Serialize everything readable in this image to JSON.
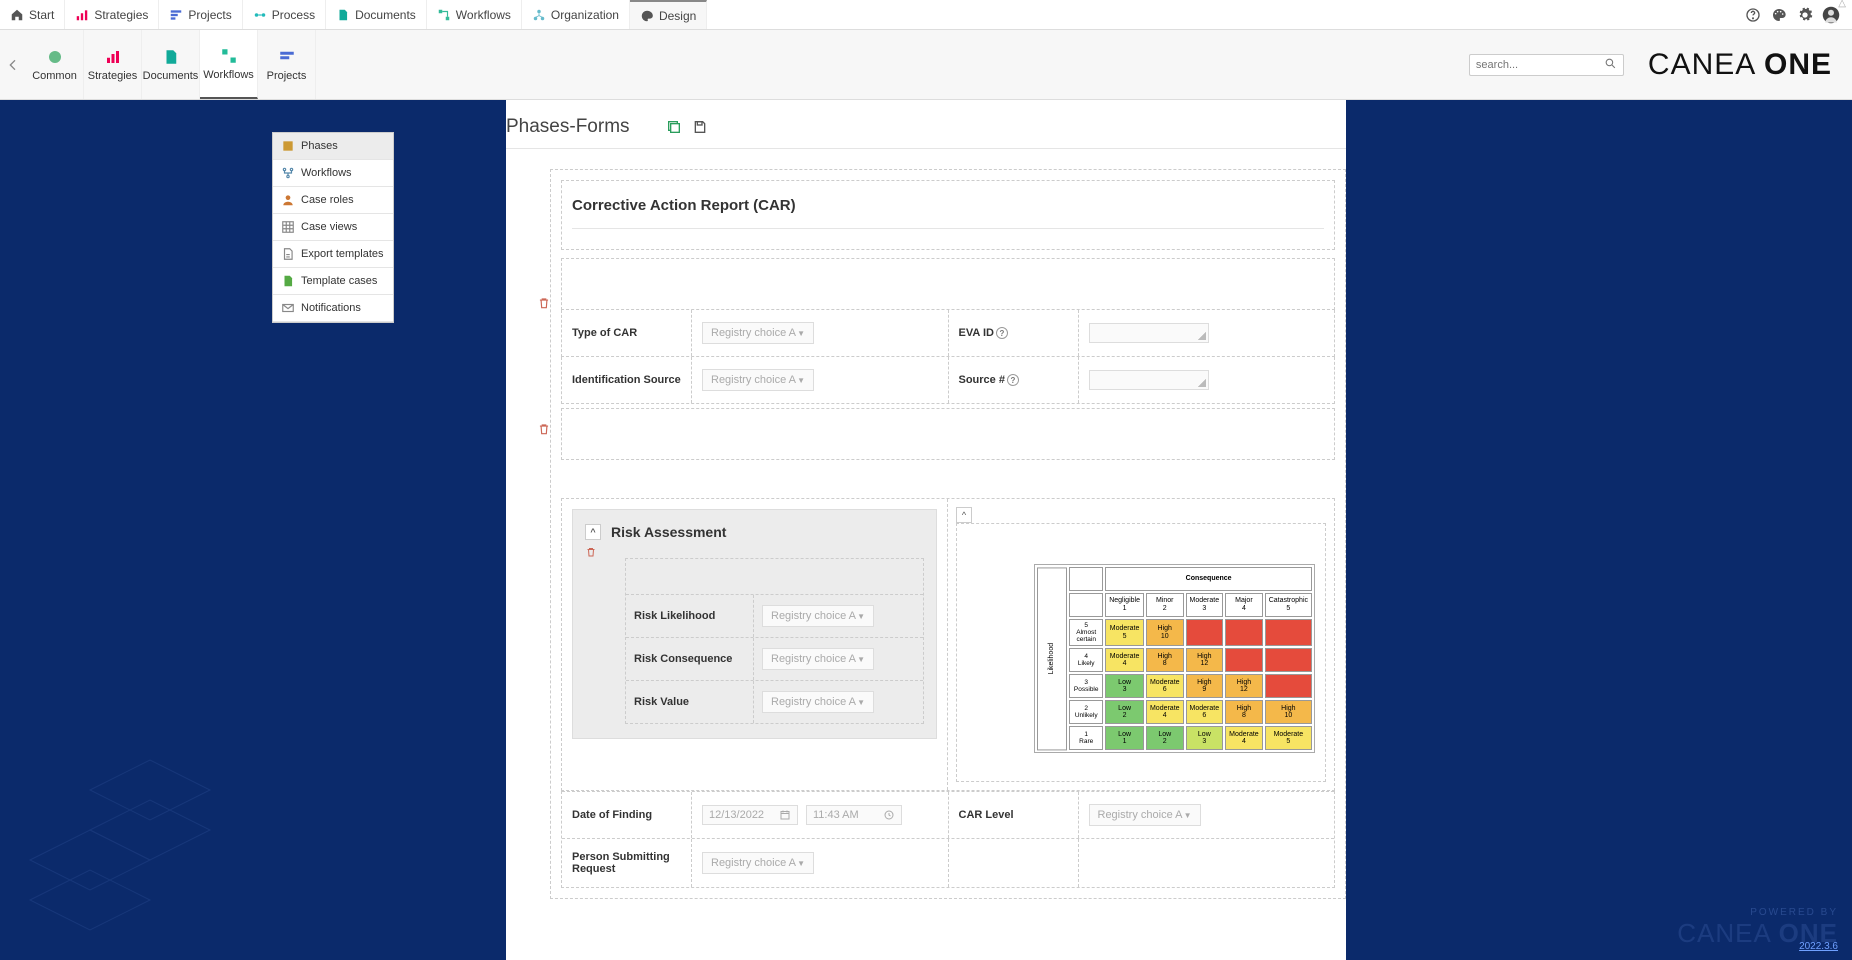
{
  "topnav": {
    "tabs": [
      {
        "label": "Start",
        "icon": "home"
      },
      {
        "label": "Strategies",
        "icon": "signal"
      },
      {
        "label": "Projects",
        "icon": "proj"
      },
      {
        "label": "Process",
        "icon": "process"
      },
      {
        "label": "Documents",
        "icon": "doc"
      },
      {
        "label": "Workflows",
        "icon": "flow"
      },
      {
        "label": "Organization",
        "icon": "org"
      },
      {
        "label": "Design",
        "icon": "design"
      }
    ],
    "active_index": 7
  },
  "ribbon": {
    "items": [
      {
        "label": "Common"
      },
      {
        "label": "Strategies"
      },
      {
        "label": "Documents"
      },
      {
        "label": "Workflows"
      },
      {
        "label": "Projects"
      }
    ],
    "active_index": 3,
    "search_placeholder": "search..."
  },
  "brand": {
    "left": "CANEA",
    "right": "ONE"
  },
  "sidebar": {
    "items": [
      {
        "label": "Phases"
      },
      {
        "label": "Workflows"
      },
      {
        "label": "Case roles"
      },
      {
        "label": "Case views"
      },
      {
        "label": "Export templates"
      },
      {
        "label": "Template cases"
      },
      {
        "label": "Notifications"
      }
    ],
    "active_index": 0
  },
  "page": {
    "title": "Phases-Forms",
    "form_title": "Corrective Action Report (CAR)"
  },
  "fields": {
    "type_of_car": {
      "label": "Type of CAR",
      "placeholder": "Registry choice A"
    },
    "eva_id": {
      "label": "EVA ID"
    },
    "identification_source": {
      "label": "Identification Source",
      "placeholder": "Registry choice A"
    },
    "source_num": {
      "label": "Source #"
    },
    "risk": {
      "title": "Risk Assessment",
      "likelihood": {
        "label": "Risk Likelihood",
        "placeholder": "Registry choice A"
      },
      "consequence": {
        "label": "Risk Consequence",
        "placeholder": "Registry choice A"
      },
      "value": {
        "label": "Risk Value",
        "placeholder": "Registry choice A"
      }
    },
    "date_of_finding": {
      "label": "Date of Finding",
      "date": "12/13/2022",
      "time": "11:43 AM"
    },
    "car_level": {
      "label": "CAR Level",
      "placeholder": "Registry choice A"
    },
    "submitter": {
      "label": "Person Submitting Request",
      "placeholder": "Registry choice A"
    }
  },
  "matrix": {
    "title": "Consequence",
    "y_axis": "Likelihood",
    "cols": [
      {
        "name": "Negligible",
        "num": "1"
      },
      {
        "name": "Minor",
        "num": "2"
      },
      {
        "name": "Moderate",
        "num": "3"
      },
      {
        "name": "Major",
        "num": "4"
      },
      {
        "name": "Catastrophic",
        "num": "5"
      }
    ],
    "rows": [
      {
        "name": "Almost certain",
        "num": "5",
        "cells": [
          {
            "t": "Moderate",
            "v": "5",
            "c": "c-yellow"
          },
          {
            "t": "High",
            "v": "10",
            "c": "c-orange"
          },
          {
            "t": "",
            "v": "",
            "c": "c-red"
          },
          {
            "t": "",
            "v": "",
            "c": "c-red"
          },
          {
            "t": "",
            "v": "",
            "c": "c-red"
          }
        ]
      },
      {
        "name": "Likely",
        "num": "4",
        "cells": [
          {
            "t": "Moderate",
            "v": "4",
            "c": "c-yellow"
          },
          {
            "t": "High",
            "v": "8",
            "c": "c-orange"
          },
          {
            "t": "High",
            "v": "12",
            "c": "c-orange"
          },
          {
            "t": "",
            "v": "",
            "c": "c-red"
          },
          {
            "t": "",
            "v": "",
            "c": "c-red"
          }
        ]
      },
      {
        "name": "Possible",
        "num": "3",
        "cells": [
          {
            "t": "Low",
            "v": "3",
            "c": "c-green"
          },
          {
            "t": "Moderate",
            "v": "6",
            "c": "c-yellow"
          },
          {
            "t": "High",
            "v": "9",
            "c": "c-orange"
          },
          {
            "t": "High",
            "v": "12",
            "c": "c-orange"
          },
          {
            "t": "",
            "v": "",
            "c": "c-red"
          }
        ]
      },
      {
        "name": "Unlikely",
        "num": "2",
        "cells": [
          {
            "t": "Low",
            "v": "2",
            "c": "c-green"
          },
          {
            "t": "Moderate",
            "v": "4",
            "c": "c-yellow"
          },
          {
            "t": "Moderate",
            "v": "6",
            "c": "c-yellow"
          },
          {
            "t": "High",
            "v": "8",
            "c": "c-orange"
          },
          {
            "t": "High",
            "v": "10",
            "c": "c-orange"
          }
        ]
      },
      {
        "name": "Rare",
        "num": "1",
        "cells": [
          {
            "t": "Low",
            "v": "1",
            "c": "c-green"
          },
          {
            "t": "Low",
            "v": "2",
            "c": "c-green"
          },
          {
            "t": "Low",
            "v": "3",
            "c": "c-ygreen"
          },
          {
            "t": "Moderate",
            "v": "4",
            "c": "c-yellow"
          },
          {
            "t": "Moderate",
            "v": "5",
            "c": "c-yellow"
          }
        ]
      }
    ]
  },
  "footer": {
    "powered": "POWERED BY",
    "brand_left": "CANEA",
    "brand_right": "ONE",
    "version": "2022.3.6"
  }
}
